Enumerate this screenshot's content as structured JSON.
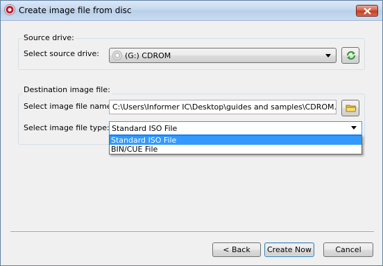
{
  "window": {
    "title": "Create image file from disc"
  },
  "source": {
    "group_label": "Source drive:",
    "drive_label": "Select source drive:",
    "drive_value": "(G:) CDROM",
    "drive_icon": "cd-drive-icon",
    "refresh_icon": "refresh-icon"
  },
  "destination": {
    "group_label": "Destination image file:",
    "name_label": "Select image file name:",
    "name_value": "C:\\Users\\Informer IC\\Desktop\\guides and samples\\CDROM.iso",
    "browse_icon": "folder-icon",
    "type_label": "Select image file type:",
    "type_value": "Standard ISO File",
    "type_options": [
      "Standard ISO File",
      "BIN/CUE File"
    ]
  },
  "buttons": {
    "back": "< Back",
    "create": "Create Now",
    "cancel": "Cancel"
  },
  "colors": {
    "selection": "#3399ff",
    "close_button": "#c23b22"
  }
}
